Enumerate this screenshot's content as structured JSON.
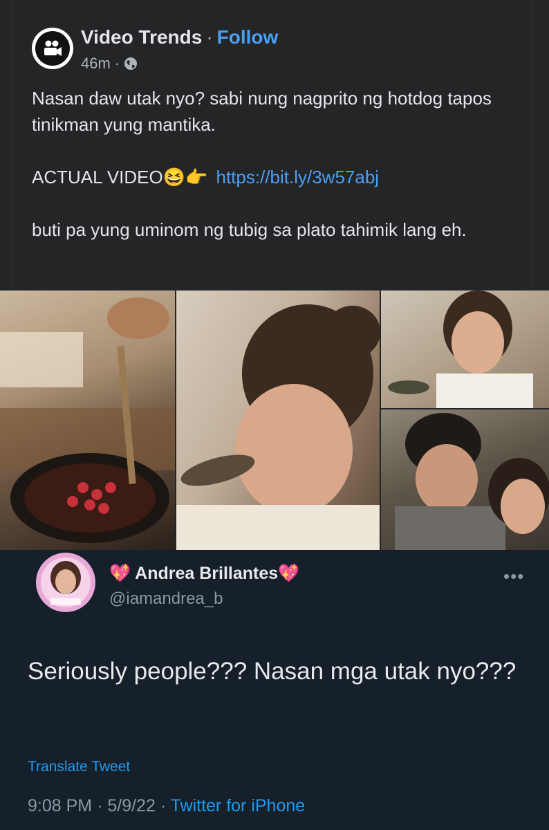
{
  "fb_post": {
    "page_name": "Video Trends",
    "separator": "·",
    "follow_label": "Follow",
    "time": "46m",
    "meta_separator": "·",
    "audience_icon": "globe-icon",
    "text_line1": "Nasan daw utak nyo? sabi nung nagprito ng hotdog tapos tinikman yung mantika.",
    "text_line2_prefix": "ACTUAL VIDEO",
    "text_line2_emoji": "😆👉",
    "text_line2_link": "https://bit.ly/3w57abj",
    "text_line3": "buti pa yung uminom ng tubig sa plato tahimik lang eh."
  },
  "tweet": {
    "name": "Andrea Brillantes",
    "name_prefix_emoji": "💖",
    "name_suffix_emoji": "💖",
    "handle": "@iamandrea_b",
    "more_icon": "more-options-icon",
    "more_label": "•••",
    "body": "Seriously people??? Nasan mga utak nyo???",
    "translate_label": "Translate Tweet",
    "time": "9:08 PM",
    "sep1": "·",
    "date": "5/9/22",
    "sep2": "·",
    "source": "Twitter for iPhone"
  },
  "colors": {
    "fb_background": "#242526",
    "fb_link": "#4b9ff5",
    "tweet_background": "#15202b",
    "twitter_blue": "#1d9bf0"
  }
}
